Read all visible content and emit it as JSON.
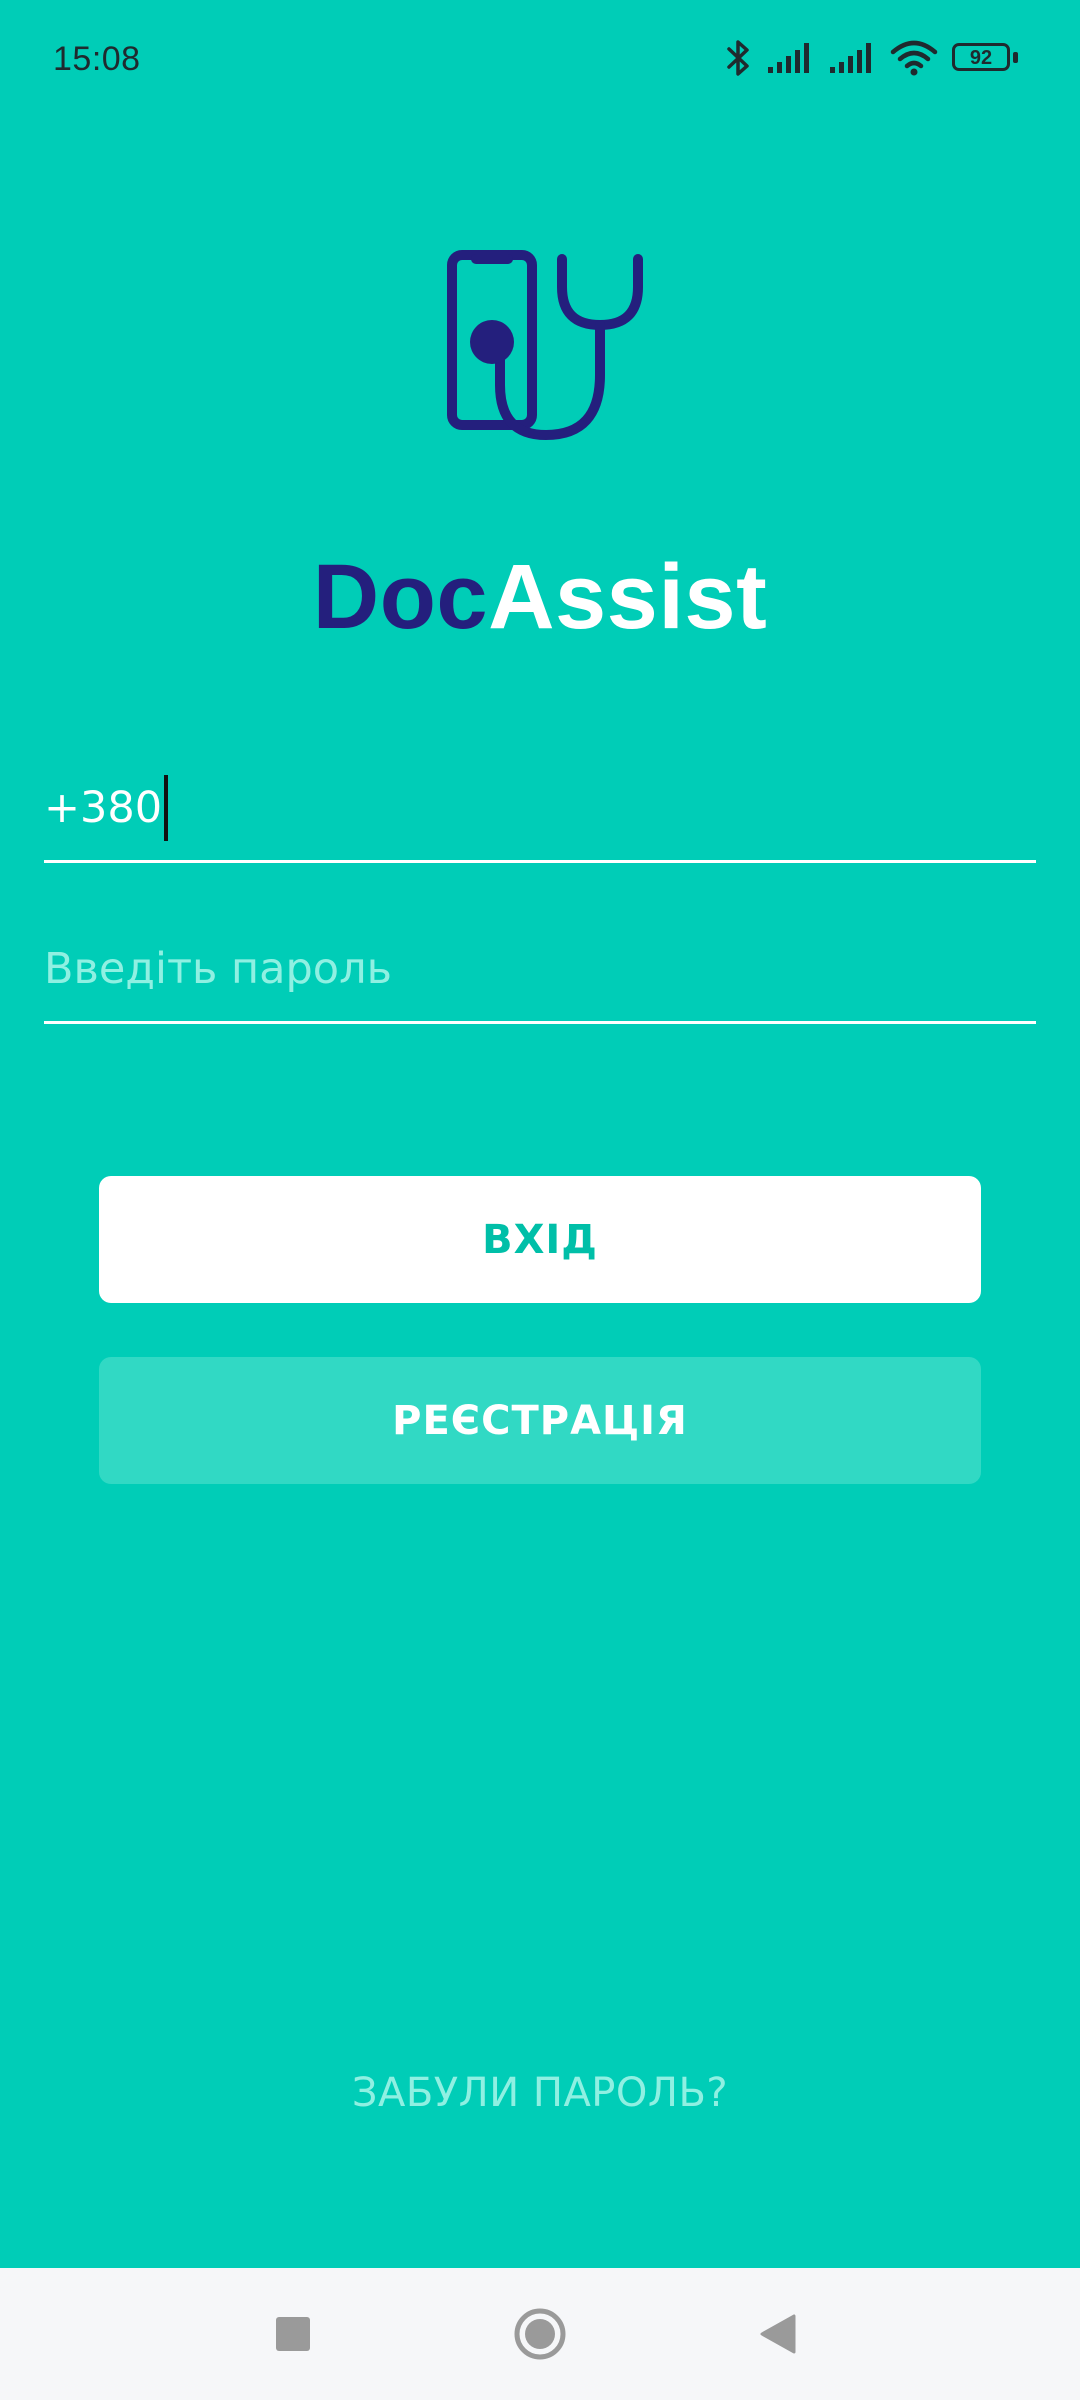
{
  "status_bar": {
    "time": "15:08",
    "battery_level": "92",
    "icons": [
      "bluetooth-icon",
      "signal-icon",
      "signal-icon",
      "wifi-icon",
      "battery-icon"
    ]
  },
  "app": {
    "title_part1": "Doc",
    "title_part2": "Assist",
    "title_color_part1": "#241f7d",
    "title_color_part2": "#ffffff",
    "logo_icon": "phone-stethoscope-icon"
  },
  "form": {
    "phone_value": "+380",
    "password_placeholder": "Введіть пароль",
    "login_label": "ВХІД",
    "register_label": "РЕЄСТРАЦІЯ",
    "forgot_label": "ЗАБУЛИ ПАРОЛЬ?"
  },
  "colors": {
    "background": "#00CDB7",
    "accent_dark": "#241f7d",
    "login_text": "#00BFA8"
  },
  "nav_bar": {
    "items": [
      "recent-apps-icon",
      "home-icon",
      "back-icon"
    ]
  }
}
